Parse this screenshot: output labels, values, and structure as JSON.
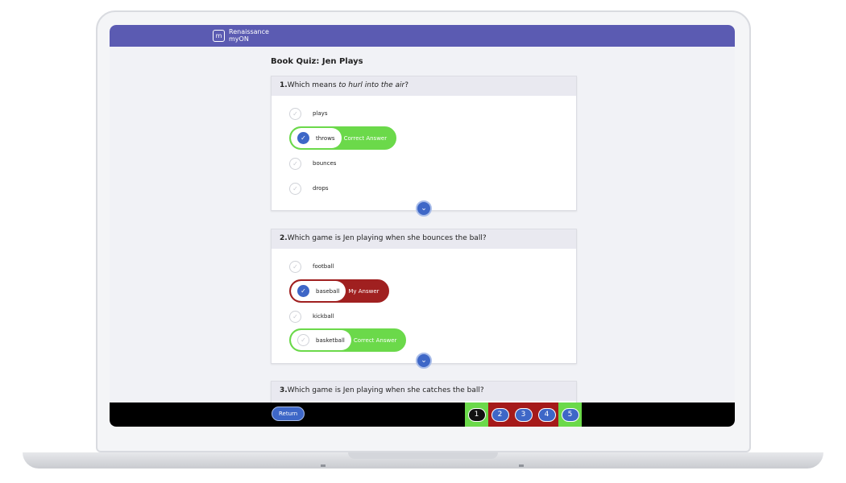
{
  "header": {
    "brand_line1": "Renaissance",
    "brand_line2": "myON"
  },
  "quiz": {
    "title": "Book Quiz: Jen Plays",
    "questions": [
      {
        "number": "1.",
        "text_before": "Which means ",
        "text_emphasis": "to hurl into the air",
        "text_after": "?",
        "options": [
          "plays",
          "throws",
          "bounces",
          "drops"
        ],
        "selected": "throws",
        "correct": "throws",
        "correct_tag": "Correct Answer"
      },
      {
        "number": "2.",
        "text": "Which game is Jen playing when she bounces the ball?",
        "options": [
          "football",
          "baseball",
          "kickball",
          "basketball"
        ],
        "selected": "baseball",
        "my_answer_tag": "My Answer",
        "correct": "basketball",
        "correct_tag": "Correct Answer"
      },
      {
        "number": "3.",
        "text": "Which game is Jen playing when she catches the ball?"
      }
    ]
  },
  "footer": {
    "return_label": "Return",
    "pages": [
      {
        "label": "1",
        "status": "correct",
        "current": true
      },
      {
        "label": "2",
        "status": "incorrect",
        "current": false
      },
      {
        "label": "3",
        "status": "incorrect",
        "current": false
      },
      {
        "label": "4",
        "status": "incorrect",
        "current": false
      },
      {
        "label": "5",
        "status": "correct",
        "current": false
      }
    ]
  },
  "colors": {
    "header": "#5b5bb2",
    "correct": "#6bd94a",
    "incorrect": "#a02020",
    "accent": "#3e67c7"
  },
  "icons": {
    "check": "check-icon",
    "expand": "chevron-down-icon"
  }
}
